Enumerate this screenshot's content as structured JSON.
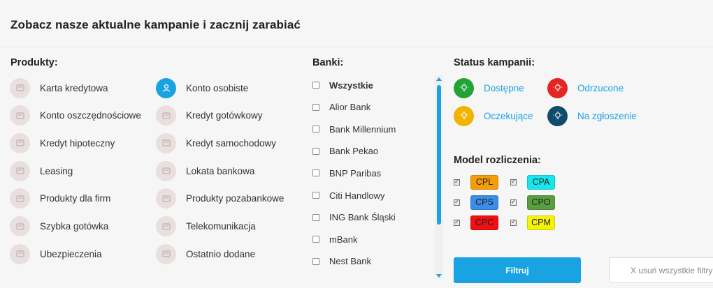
{
  "header": {
    "title": "Zobacz nasze aktualne kampanie i zacznij zarabiać"
  },
  "products": {
    "heading": "Produkty:",
    "items": [
      {
        "label": "Karta kredytowa",
        "icon": "credit-card-icon",
        "active": false
      },
      {
        "label": "Konto osobiste",
        "icon": "user-icon",
        "active": true
      },
      {
        "label": "Konto oszczędnościowe",
        "icon": "piggy-bank-icon",
        "active": false
      },
      {
        "label": "Kredyt gotówkowy",
        "icon": "cash-icon",
        "active": false
      },
      {
        "label": "Kredyt hipoteczny",
        "icon": "house-icon",
        "active": false
      },
      {
        "label": "Kredyt samochodowy",
        "icon": "car-icon",
        "active": false
      },
      {
        "label": "Leasing",
        "icon": "stack-icon",
        "active": false
      },
      {
        "label": "Lokata bankowa",
        "icon": "bank-icon",
        "active": false
      },
      {
        "label": "Produkty dla firm",
        "icon": "chart-icon",
        "active": false
      },
      {
        "label": "Produkty pozabankowe",
        "icon": "no-bank-icon",
        "active": false
      },
      {
        "label": "Szybka gotówka",
        "icon": "money-fast-icon",
        "active": false
      },
      {
        "label": "Telekomunikacja",
        "icon": "phone-icon",
        "active": false
      },
      {
        "label": "Ubezpieczenia",
        "icon": "umbrella-icon",
        "active": false
      },
      {
        "label": "Ostatnio dodane",
        "icon": "history-icon",
        "active": false
      }
    ]
  },
  "banks": {
    "heading": "Banki:",
    "items": [
      {
        "label": "Wszystkie",
        "bold": true
      },
      {
        "label": "Alior Bank"
      },
      {
        "label": "Bank Millennium"
      },
      {
        "label": "Bank Pekao"
      },
      {
        "label": "BNP Paribas"
      },
      {
        "label": "Citi Handlowy"
      },
      {
        "label": "ING Bank Śląski"
      },
      {
        "label": "mBank"
      },
      {
        "label": "Nest Bank"
      }
    ]
  },
  "status": {
    "heading": "Status kampanii:",
    "items": [
      {
        "label": "Dostępne",
        "color": "#22a336"
      },
      {
        "label": "Odrzucone",
        "color": "#e52521"
      },
      {
        "label": "Oczekujące",
        "color": "#f0b400"
      },
      {
        "label": "Na zgłoszenie",
        "color": "#0f4c6e"
      }
    ]
  },
  "model": {
    "heading": "Model rozliczenia:",
    "items": [
      {
        "label": "CPL",
        "color": "#f59c0b",
        "checked": true
      },
      {
        "label": "CPA",
        "color": "#18e6ec",
        "checked": true
      },
      {
        "label": "CPS",
        "color": "#3a8ee6",
        "checked": true
      },
      {
        "label": "CPO",
        "color": "#5a9f3f",
        "checked": true
      },
      {
        "label": "CPC",
        "color": "#ef1010",
        "checked": true
      },
      {
        "label": "CPM",
        "color": "#f5f20a",
        "checked": true
      }
    ]
  },
  "actions": {
    "filter_label": "Filtruj",
    "clear_label": "X usuń wszystkie filtry"
  }
}
